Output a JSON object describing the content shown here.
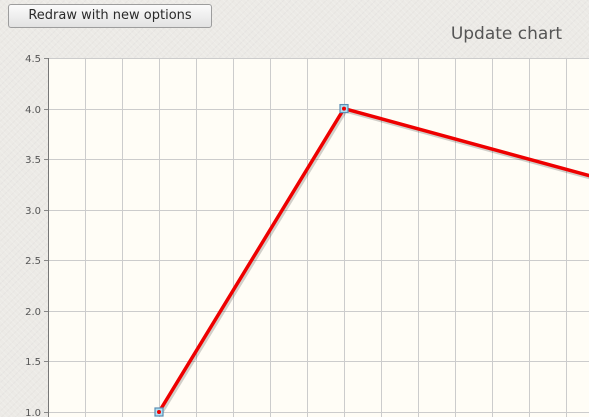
{
  "toolbar": {
    "redraw_label": "Redraw with new options"
  },
  "chart": {
    "title": "Update chart"
  },
  "chart_data": {
    "type": "line",
    "title": "Update chart",
    "xlabel": "",
    "ylabel": "",
    "ylim": [
      1.0,
      4.5
    ],
    "yticks": [
      "1.0",
      "1.5",
      "2.0",
      "2.5",
      "3.0",
      "3.5",
      "4.0",
      "4.5"
    ],
    "grid": true,
    "series": [
      {
        "color": "#ee0000",
        "marker": "square",
        "points": [
          {
            "x": 3,
            "y": 1.0
          },
          {
            "x": 8,
            "y": 4.0
          },
          {
            "x": 15,
            "y": 3.3
          }
        ]
      }
    ],
    "colors": {
      "plot_background": "#fffdf6",
      "grid": "#cccccc",
      "line": "#ee0000",
      "marker_fill": "#aee0f2",
      "marker_stroke": "#5a8eb3"
    }
  }
}
